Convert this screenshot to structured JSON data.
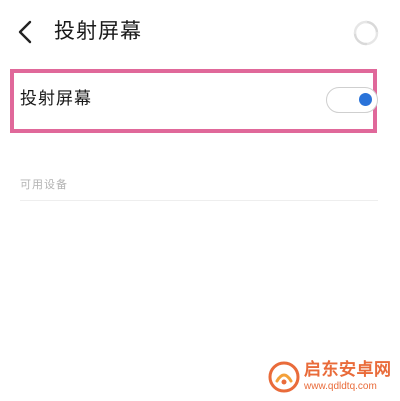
{
  "header": {
    "title": "投射屏幕",
    "back_icon": "chevron-left-icon",
    "loading_icon": "loading-spinner-icon"
  },
  "cast_row": {
    "label": "投射屏幕",
    "toggle_state": "on",
    "highlight_color": "#e0689a",
    "toggle_accent": "#2a73d9"
  },
  "devices_section": {
    "label": "可用设备"
  },
  "watermark": {
    "main_text": "启东安卓网",
    "url_text": "www.qdldtq.com",
    "color": "#e96b3a"
  }
}
